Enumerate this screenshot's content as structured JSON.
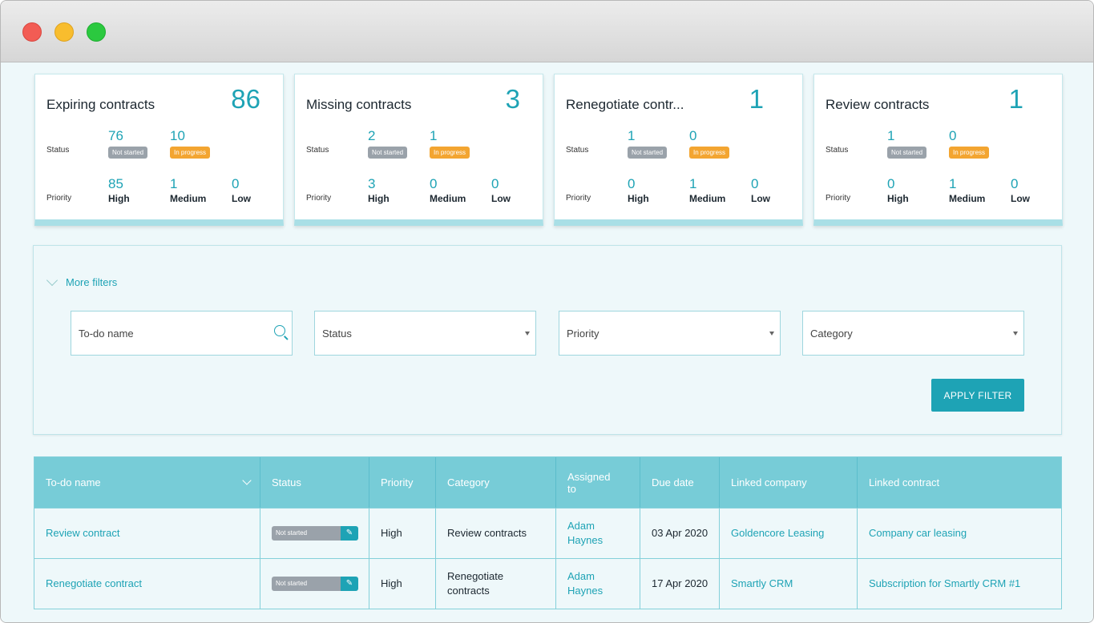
{
  "cards": [
    {
      "title": "Expiring contracts",
      "count": "86",
      "status_label": "Status",
      "priority_label": "Priority",
      "not_started": "76",
      "in_progress": "10",
      "high": "85",
      "medium": "1",
      "low": "0"
    },
    {
      "title": "Missing contracts",
      "count": "3",
      "status_label": "Status",
      "priority_label": "Priority",
      "not_started": "2",
      "in_progress": "1",
      "high": "3",
      "medium": "0",
      "low": "0"
    },
    {
      "title": "Renegotiate contr...",
      "count": "1",
      "status_label": "Status",
      "priority_label": "Priority",
      "not_started": "1",
      "in_progress": "0",
      "high": "0",
      "medium": "1",
      "low": "0"
    },
    {
      "title": "Review contracts",
      "count": "1",
      "status_label": "Status",
      "priority_label": "Priority",
      "not_started": "1",
      "in_progress": "0",
      "high": "0",
      "medium": "1",
      "low": "0"
    }
  ],
  "badges": {
    "not_started": "Not started",
    "in_progress": "In progress"
  },
  "priority_names": {
    "high": "High",
    "medium": "Medium",
    "low": "Low"
  },
  "filters": {
    "more_filters_label": "More filters",
    "todo_placeholder": "To-do name",
    "status_placeholder": "Status",
    "priority_placeholder": "Priority",
    "category_placeholder": "Category",
    "apply_label": "APPLY FILTER"
  },
  "table": {
    "headers": [
      "To-do name",
      "Status",
      "Priority",
      "Category",
      "Assigned to",
      "Due date",
      "Linked company",
      "Linked contract"
    ],
    "rows": [
      {
        "name": "Review contract",
        "status": "Not started",
        "priority": "High",
        "category": "Review contracts",
        "assigned": "Adam Haynes",
        "due": "03 Apr 2020",
        "company": "Goldencore Leasing",
        "contract": "Company car leasing"
      },
      {
        "name": "Renegotiate contract",
        "status": "Not started",
        "priority": "High",
        "category": "Renegotiate contracts",
        "assigned": "Adam Haynes",
        "due": "17 Apr 2020",
        "company": "Smartly CRM",
        "contract": "Subscription for Smartly CRM #1"
      }
    ]
  },
  "colors": {
    "accent": "#1ea3b5",
    "header": "#77ccd7",
    "badge_grey": "#9aa2aa",
    "badge_orange": "#f3a531"
  }
}
